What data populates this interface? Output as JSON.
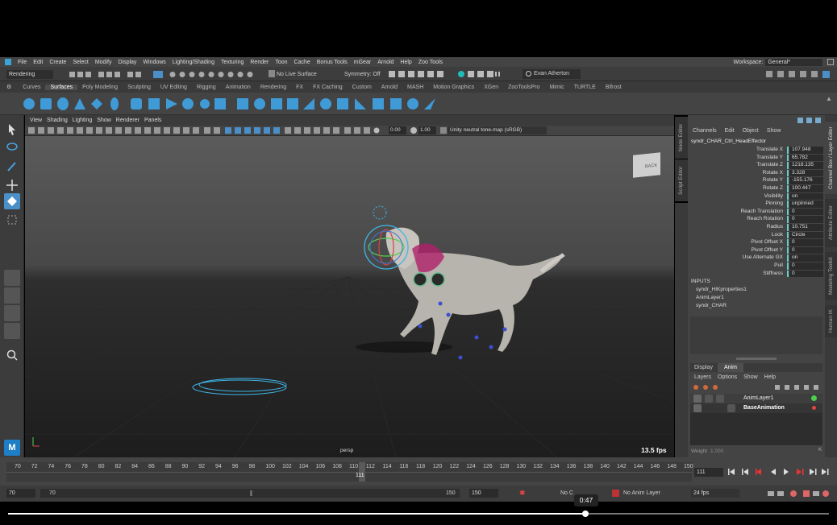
{
  "menu": [
    "File",
    "Edit",
    "Create",
    "Select",
    "Modify",
    "Display",
    "Windows",
    "Lighting/Shading",
    "Texturing",
    "Render",
    "Toon",
    "Cache",
    "Bonus Tools",
    "mGear",
    "Arnold",
    "Help",
    "Zoo Tools"
  ],
  "workspace": {
    "label": "Workspace:",
    "value": "General*"
  },
  "status": {
    "mode": "Rendering",
    "live_surface": "No Live Surface",
    "symmetry": "Symmetry: Off",
    "user": "Evan Atherton"
  },
  "shelf_tabs": [
    "Curves",
    "Surfaces",
    "Poly Modeling",
    "Sculpting",
    "UV Editing",
    "Rigging",
    "Animation",
    "Rendering",
    "FX",
    "FX Caching",
    "Custom",
    "Arnold",
    "MASH",
    "Motion Graphics",
    "XGen",
    "ZooToolsPro",
    "Mimic",
    "TURTLE",
    "Bifrost"
  ],
  "active_shelf": "Surfaces",
  "viewport": {
    "menu": [
      "View",
      "Shading",
      "Lighting",
      "Show",
      "Renderer",
      "Panels"
    ],
    "value_a": "0.00",
    "value_b": "1.00",
    "colorspace": "Unity neutral tone-map (sRGB)",
    "camera": "persp",
    "fps": "13.5 fps",
    "viewcube": "BACK"
  },
  "side_tabs": {
    "left": [
      "Node Editor",
      "Script Editor"
    ],
    "right": [
      "Channel Box / Layer Editor",
      "Attribute Editor",
      "Modeling Toolkit",
      "Human IK"
    ]
  },
  "channel_box": {
    "menu": [
      "Channels",
      "Edit",
      "Object",
      "Show"
    ],
    "node": "syndr_CHAR_Ctrl_HeadEffector",
    "attributes": [
      {
        "name": "Translate X",
        "value": "107.948"
      },
      {
        "name": "Translate Y",
        "value": "65.782"
      },
      {
        "name": "Translate Z",
        "value": "1218.135"
      },
      {
        "name": "Rotate X",
        "value": "3.328"
      },
      {
        "name": "Rotate Y",
        "value": "-155.176"
      },
      {
        "name": "Rotate Z",
        "value": "100.447"
      },
      {
        "name": "Visibility",
        "value": "on"
      },
      {
        "name": "Pinning",
        "value": "unpinned"
      },
      {
        "name": "Reach Translation",
        "value": "0"
      },
      {
        "name": "Reach Rotation",
        "value": "0"
      },
      {
        "name": "Radius",
        "value": "10.751"
      },
      {
        "name": "Look",
        "value": "Circle"
      },
      {
        "name": "Pivot Offset X",
        "value": "0"
      },
      {
        "name": "Pivot Offset Y",
        "value": "0"
      },
      {
        "name": "Use Alternate GX",
        "value": "on"
      },
      {
        "name": "Pull",
        "value": "0"
      },
      {
        "name": "Stiffness",
        "value": "0"
      }
    ],
    "inputs_label": "INPUTS",
    "inputs": [
      "syndr_HIKproperties1",
      "AnimLayer1",
      "syndr_CHAR"
    ]
  },
  "layer_editor": {
    "tabs": [
      "Display",
      "Anim"
    ],
    "active_tab": "Anim",
    "menu": [
      "Layers",
      "Options",
      "Show",
      "Help"
    ],
    "layers": [
      "AnimLayer1",
      "BaseAnimation"
    ],
    "weight_label": "Weight",
    "weight_value": "1.000"
  },
  "timeline": {
    "ticks": [
      "70",
      "72",
      "74",
      "76",
      "78",
      "80",
      "82",
      "84",
      "86",
      "88",
      "90",
      "92",
      "94",
      "96",
      "98",
      "100",
      "102",
      "104",
      "106",
      "108",
      "110",
      "112",
      "114",
      "116",
      "118",
      "120",
      "122",
      "124",
      "126",
      "128",
      "130",
      "132",
      "134",
      "136",
      "138",
      "140",
      "142",
      "144",
      "146",
      "148",
      "150"
    ],
    "current_frame": "111",
    "current_field": "111"
  },
  "range": {
    "start": "70",
    "inner_start": "70",
    "inner_end": "150",
    "end": "150",
    "character": "No C",
    "anim_layer": "No Anim Layer",
    "fps": "24 fps"
  },
  "video": {
    "time": "0:47"
  }
}
